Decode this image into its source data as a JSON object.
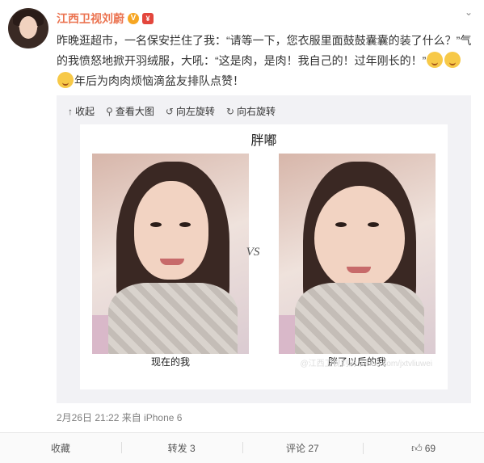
{
  "post": {
    "username": "江西卫视刘蔚",
    "v_badge": "V",
    "vip_badge": "¥",
    "text_line1": "昨晚逛超市，一名保安拦住了我：“请等一下，您衣服里面鼓鼓囊囊的装了什么？”气",
    "text_line2": "的我愤怒地掀开羽绒服，大吼：“这是肉，是肉！我自己的！过年刚长的！”",
    "text_line3": "年后为肉肉烦恼滴盆友排队点赞！",
    "emoji_name": "laughing-face-icon"
  },
  "toolbar": {
    "collapse": "收起",
    "view_large": "查看大图",
    "rotate_left": "向左旋转",
    "rotate_right": "向右旋转"
  },
  "image": {
    "title": "胖嘟",
    "vs": "VS",
    "left_caption": "现在的我",
    "right_caption": "胖了以后的我",
    "watermark": "@江西卫视刘蔚 weibo.com/jxtvliuwei"
  },
  "meta": {
    "timestamp_source": "2月26日 21:22 来自 iPhone 6"
  },
  "footer": {
    "favorite": "收藏",
    "repost": "转发 3",
    "comment": "评论 27",
    "like": "69"
  }
}
